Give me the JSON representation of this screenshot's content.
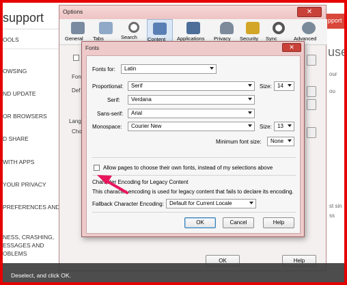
{
  "support_page": {
    "title": "support",
    "items": [
      "OOLS",
      "OWSING",
      "ND UPDATE",
      "OR BROWSERS",
      "D SHARE",
      " WITH APPS",
      "YOUR PRIVACY",
      "PREFERENCES AND",
      "NESS, CRASHING,",
      "ESSAGES AND",
      "OBLEMS"
    ]
  },
  "right_page": {
    "banner": "pport",
    "heading": "use",
    "line1": "our",
    "line2": "ou",
    "line3": "st sin",
    "line4": "ss"
  },
  "options_window": {
    "title": "Options",
    "close_glyph": "✕",
    "toolbar": [
      {
        "label": "General",
        "icon": "switch-icon",
        "color": "#7a8aa0"
      },
      {
        "label": "Tabs",
        "icon": "tabs-icon",
        "color": "#8fa9c7"
      },
      {
        "label": "Search",
        "icon": "search-icon",
        "color": "#6c6c6c"
      },
      {
        "label": "Content",
        "icon": "content-icon",
        "color": "#5a7fb5"
      },
      {
        "label": "Applications",
        "icon": "applications-icon",
        "color": "#4c6e99"
      },
      {
        "label": "Privacy",
        "icon": "mask-icon",
        "color": "#7c8a9c"
      },
      {
        "label": "Security",
        "icon": "lock-icon",
        "color": "#d4a627"
      },
      {
        "label": "Sync",
        "icon": "sync-icon",
        "color": "#555555"
      },
      {
        "label": "Advanced",
        "icon": "gear-icon",
        "color": "#7a8a9a"
      }
    ],
    "bg_labels": {
      "fon": "Fon",
      "def": "Def",
      "lang": "Lang",
      "cho": "Cho"
    },
    "buttons": {
      "ok": "OK",
      "help": "Help"
    }
  },
  "fonts_dialog": {
    "title": "Fonts",
    "close_glyph": "✕",
    "fonts_for_label": "Fonts for:",
    "fonts_for_value": "Latin",
    "proportional_label": "Proportional:",
    "proportional_value": "Serif",
    "size_label": "Size:",
    "proportional_size": "14",
    "serif_label": "Serif:",
    "serif_value": "Verdana",
    "sans_serif_label": "Sans-serif:",
    "sans_serif_value": "Arial",
    "monospace_label": "Monospace:",
    "monospace_value": "Courier New",
    "monospace_size": "13",
    "min_font_label": "Minimum font size:",
    "min_font_value": "None",
    "allow_pages_label": "Allow pages to choose their own fonts, instead of my selections above",
    "encoding_heading": "Character Encoding for Legacy Content",
    "encoding_desc": "This character encoding is used for legacy content that fails to declare its encoding.",
    "fallback_label": "Fallback Character Encoding:",
    "fallback_value": "Default for Current Locale",
    "ok_label": "OK",
    "cancel_label": "Cancel",
    "help_label": "Help"
  },
  "caption": "Deselect, and click OK."
}
